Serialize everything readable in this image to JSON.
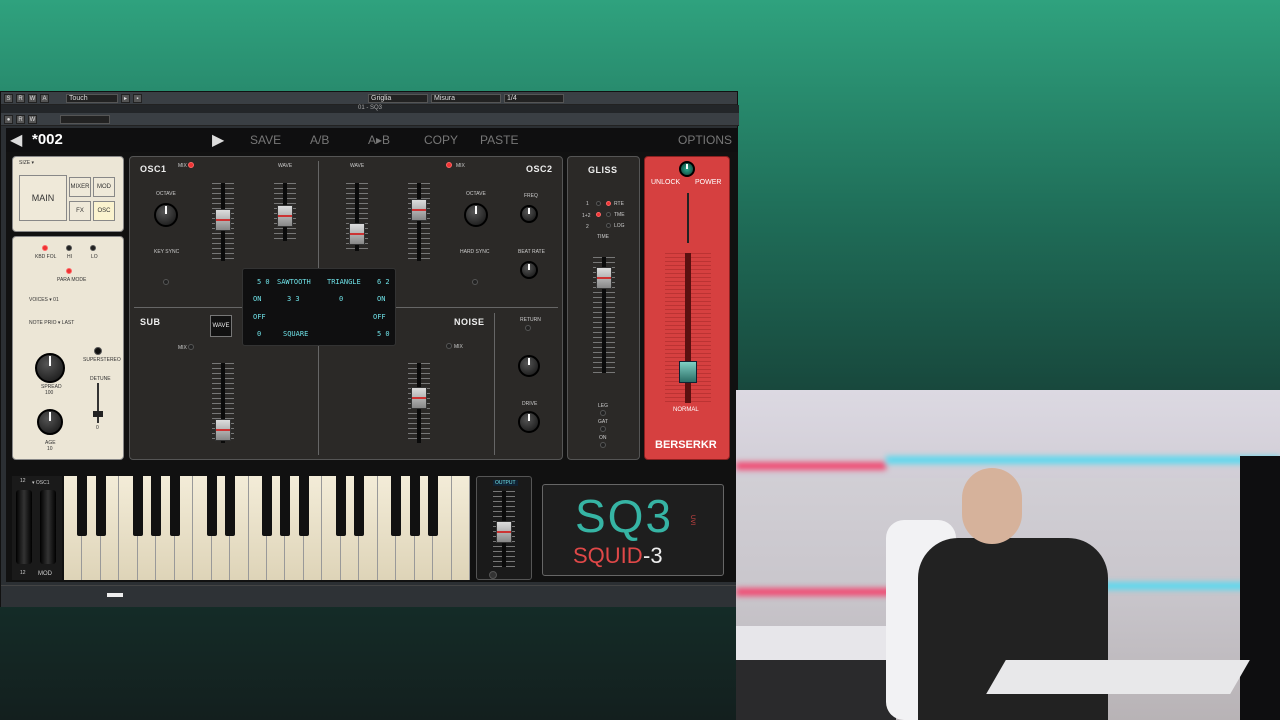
{
  "daw": {
    "title": "01 - SQ3",
    "toolbar": {
      "touch": "Touch",
      "grid": "Griglia",
      "measure": "Misura",
      "quant": "1/4",
      "letters": [
        "R",
        "W",
        "A"
      ],
      "letters2": [
        "R",
        "W"
      ]
    }
  },
  "preset": {
    "name": "*002",
    "save": "SAVE",
    "ab": "A/B",
    "atob": "A▸B",
    "copy": "COPY",
    "paste": "PASTE",
    "options": "OPTIONS"
  },
  "nav": {
    "size": "SIZE ▾",
    "main": "MAIN",
    "mixer": "MIXER",
    "mod": "MOD",
    "fx": "FX",
    "osc": "OSC"
  },
  "left": {
    "kbd": "KBD FOL",
    "hi": "HI",
    "lo": "LO",
    "para": "PARA MODE",
    "voices": "VOICES ▾  01",
    "prio": "NOTE PRIO ▾ LAST",
    "superstereo": "SUPERSTEREO",
    "spread": "SPREAD",
    "spread_val": "100",
    "detune": "DETUNE",
    "detune_val": "0",
    "age": "AGE",
    "age_val": "10"
  },
  "osc1": {
    "title": "OSC1",
    "mix": "MIX",
    "wave": "WAVE",
    "octave": "OCTAVE",
    "keysync": "KEY SYNC"
  },
  "osc2": {
    "title": "OSC2",
    "mix": "MIX",
    "wave": "WAVE",
    "octave": "OCTAVE",
    "freq": "FREQ",
    "hardsync": "HARD SYNC",
    "beat": "BEAT RATE"
  },
  "sub": {
    "title": "SUB",
    "wave": "WAVE",
    "mix": "MIX"
  },
  "noise": {
    "title": "NOISE",
    "mix": "MIX",
    "return": "RETURN",
    "drive": "DRIVE"
  },
  "lcd": {
    "r1": [
      "5 0",
      "SAWTOOTH",
      "TRIANGLE",
      "6 2"
    ],
    "r2": [
      "ON",
      "3 3",
      "0",
      "ON"
    ],
    "r3": [
      "OFF",
      "OFF"
    ],
    "r4": [
      "0",
      "SQUARE",
      "5 0"
    ]
  },
  "gliss": {
    "title": "GLISS",
    "rte": "RTE",
    "tme": "TME",
    "log": "LOG",
    "time": "TIME",
    "leg": "LEG",
    "gat": "GAT",
    "on": "ON",
    "r1": "1",
    "r2": "1+2",
    "r3": "2"
  },
  "berserkr": {
    "unlock": "UNLOCK",
    "power": "POWER",
    "normal": "NORMAL",
    "name": "BERSERKR"
  },
  "bottom": {
    "osc1": "▾ OSC1",
    "mod": "MOD",
    "output": "OUTPUT",
    "n12a": "12",
    "n12b": "12"
  },
  "logo": {
    "big": "SQ3",
    "sub1": "SQUID",
    "sub2": "-3",
    "brand": "UVI"
  }
}
